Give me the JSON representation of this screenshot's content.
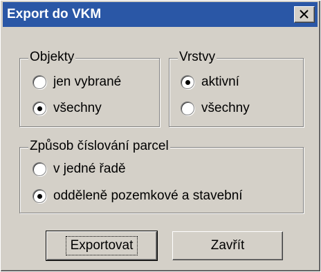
{
  "window": {
    "title": "Export do VKM"
  },
  "objekty": {
    "legend": "Objekty",
    "options": [
      {
        "label": "jen vybrané",
        "checked": false
      },
      {
        "label": "všechny",
        "checked": true
      }
    ]
  },
  "vrstvy": {
    "legend": "Vrstvy",
    "options": [
      {
        "label": "aktivní",
        "checked": true
      },
      {
        "label": "všechny",
        "checked": false
      }
    ]
  },
  "cislovani": {
    "legend": "Způsob číslování parcel",
    "options": [
      {
        "label": "v jedné řadě",
        "checked": false
      },
      {
        "label": "odděleně pozemkové a stavební",
        "checked": true
      }
    ]
  },
  "buttons": {
    "export": "Exportovat",
    "close": "Zavřít"
  },
  "colors": {
    "titlebar": "#2a57a6",
    "dialog_bg": "#d4d0c8"
  }
}
